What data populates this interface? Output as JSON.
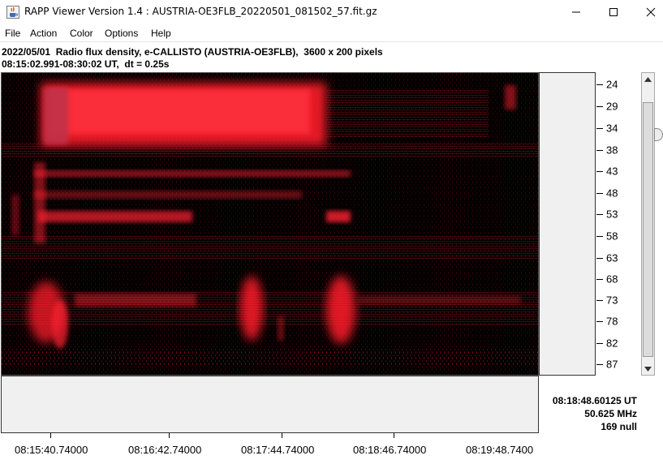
{
  "window": {
    "title": "RAPP Viewer Version 1.4 : AUSTRIA-OE3FLB_20220501_081502_57.fit.gz",
    "icon": "java-cup-icon",
    "controls": [
      "minimize",
      "maximize",
      "close"
    ]
  },
  "menu": {
    "items": [
      "File",
      "Action",
      "Color",
      "Options",
      "Help"
    ]
  },
  "info": {
    "line1": "2022/05/01  Radio flux density, e-CALLISTO (AUSTRIA-OE3FLB),  3600 x 200 pixels",
    "line2": "08:15:02.991-08:30:02 UT,  dt = 0.25s"
  },
  "y_axis": {
    "labels": [
      "24",
      "29",
      "34",
      "38",
      "43",
      "48",
      "53",
      "58",
      "63",
      "68",
      "73",
      "78",
      "82",
      "87"
    ]
  },
  "x_axis": {
    "labels": [
      "08:15:40.74000",
      "08:16:42.74000",
      "08:17:44.74000",
      "08:18:46.74000",
      "08:19:48.7400"
    ]
  },
  "readout": {
    "time": "08:18:48.60125 UT",
    "frequency": "50.625 MHz",
    "value": "169 null"
  },
  "colors": {
    "spectrogram_bg": "#000000",
    "signal": "#ff1a2a",
    "panel": "#f0f0f0"
  }
}
